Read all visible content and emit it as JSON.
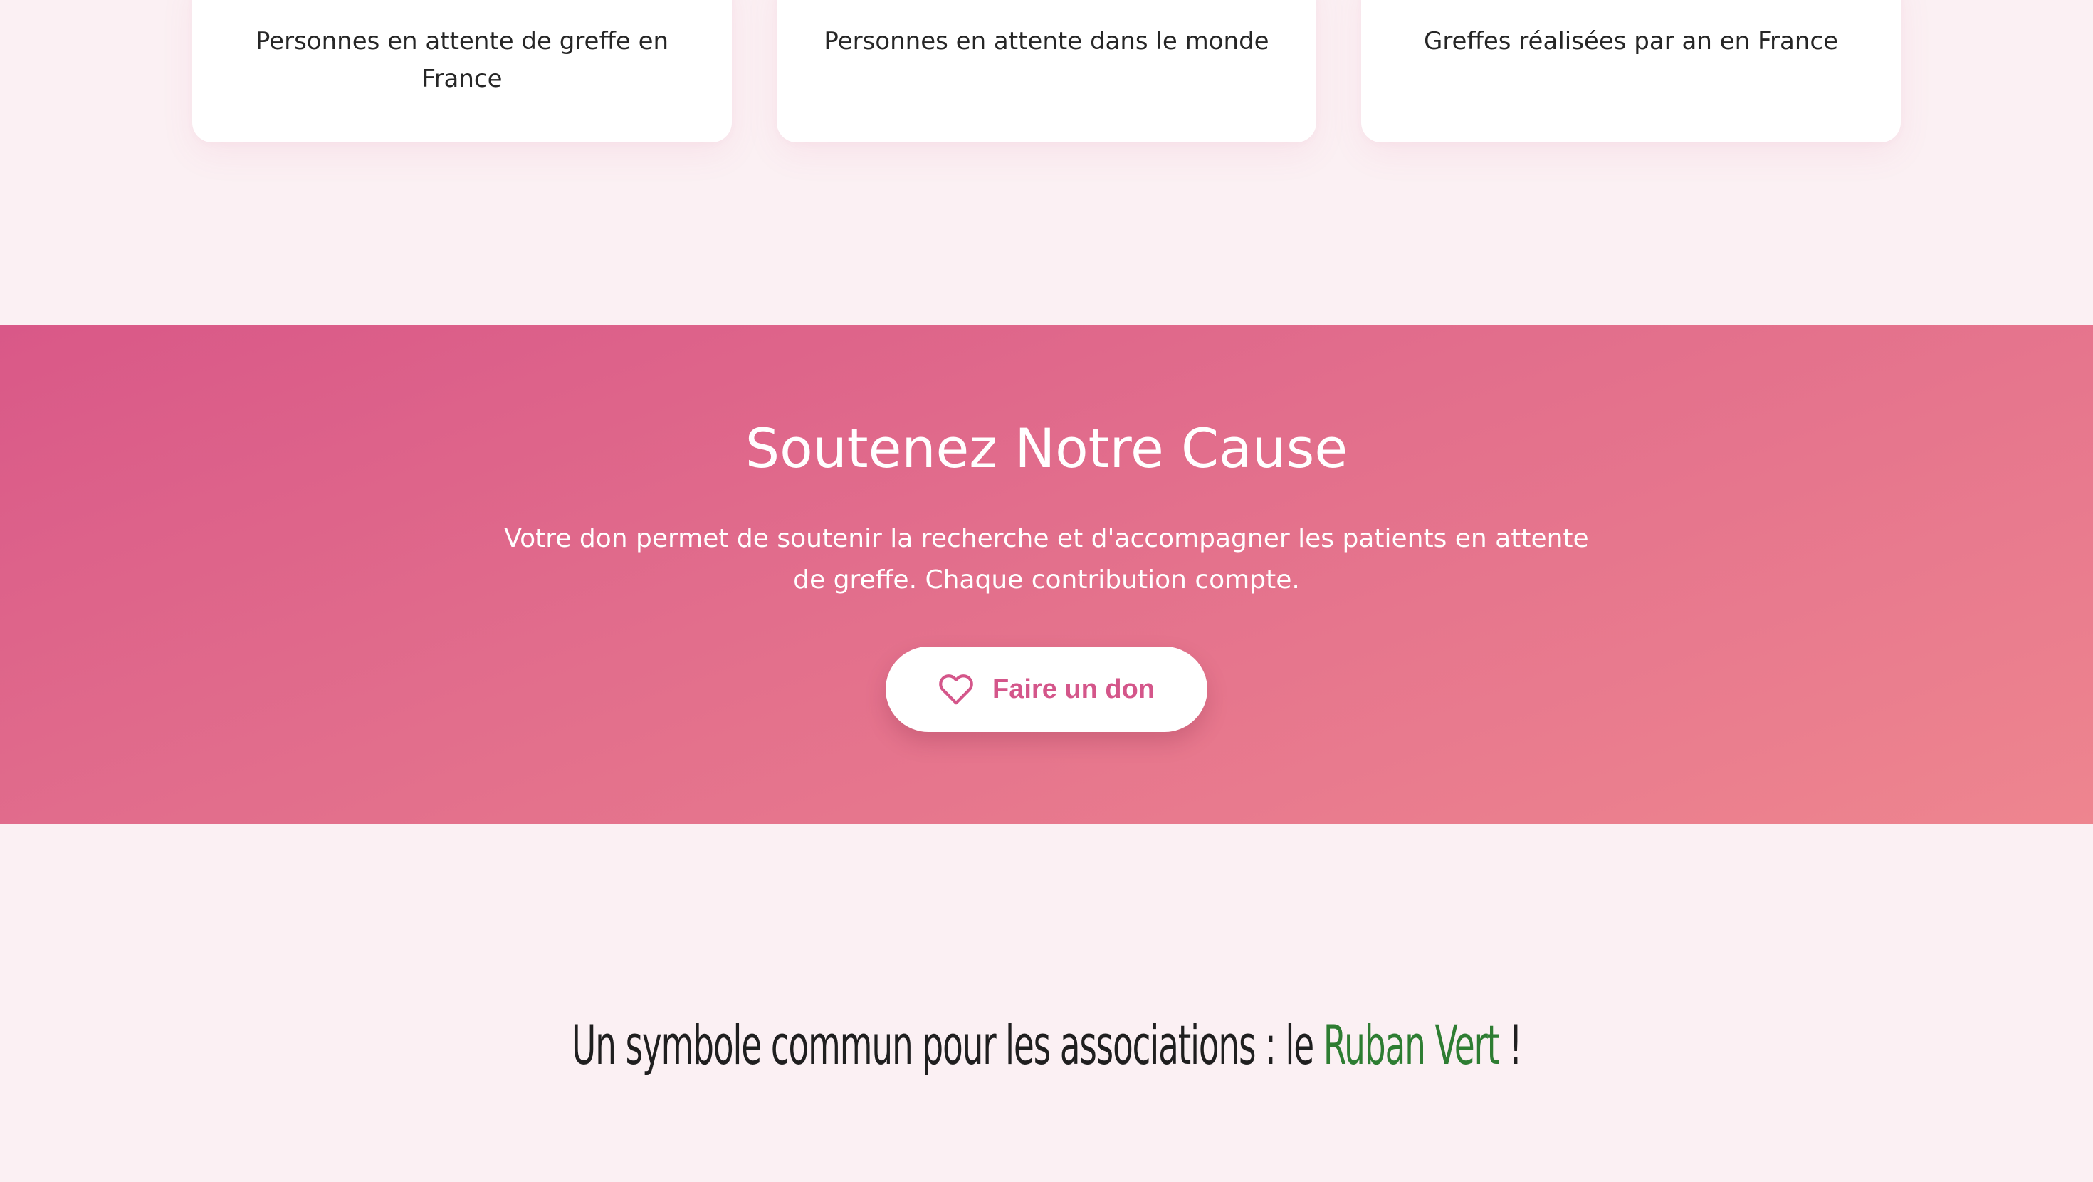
{
  "stats": [
    {
      "label": "Personnes en attente de greffe en France"
    },
    {
      "label": "Personnes en attente dans le monde"
    },
    {
      "label": "Greffes réalisées par an en France"
    }
  ],
  "support": {
    "title": "Soutenez Notre Cause",
    "text": "Votre don permet de soutenir la recherche et d'accompagner les patients en attente de greffe. Chaque contribution compte.",
    "button_label": "Faire un don",
    "button_icon": "heart-icon"
  },
  "symbol": {
    "prefix": "Un symbole commun pour les associations : le ",
    "highlight": "Ruban Vert",
    "suffix": " !"
  },
  "colors": {
    "page_background": "#fbf0f3",
    "banner_gradient_start": "#d95888",
    "banner_gradient_end": "#ee858f",
    "button_text": "#d4568a",
    "highlight_green": "#2e7d32"
  }
}
